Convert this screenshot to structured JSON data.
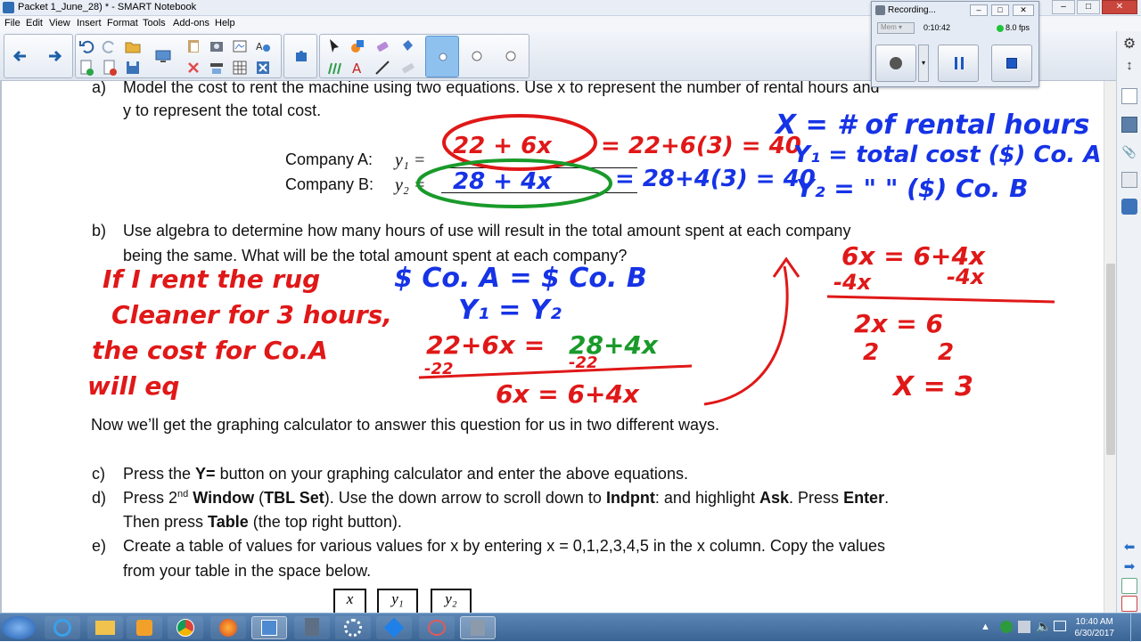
{
  "window": {
    "title": "Packet 1_June_28) * - SMART Notebook"
  },
  "menu": [
    "File",
    "Edit",
    "View",
    "Insert",
    "Format",
    "Tools",
    "Add-ons",
    "Help"
  ],
  "recording": {
    "title": "Recording...",
    "time": "0:10:42",
    "fps": "8.0 fps",
    "mode": "Mem"
  },
  "content": {
    "a_label": "a)",
    "a_line1": "Model the cost to rent the machine using two equations. Use x to represent the number of rental hours and",
    "a_line2": "y to represent the total cost.",
    "companyA": "Company A:",
    "companyB": "Company B:",
    "y1": "y₁ =",
    "y2": "y₂ =",
    "b_label": "b)",
    "b_line1": "Use algebra to determine how many hours of use will result in the total amount spent at each company",
    "b_line2": "being the same. What will be the total amount spent at each company?",
    "now_line": "Now we’ll get the graphing calculator to answer this question for us in two different ways.",
    "c_label": "c)",
    "c_pre": "Press the ",
    "c_bold": "Y=",
    "c_post": " button on your graphing calculator and enter the above equations.",
    "d_label": "d)",
    "d_p1": "Press 2",
    "d_sup": "nd",
    "d_b1": " Window",
    "d_p2": " (",
    "d_b2": "TBL Set",
    "d_p3": "). Use the down arrow to scroll down to ",
    "d_b3": "Indpnt",
    "d_p4": ": and highlight ",
    "d_b4": "Ask",
    "d_p5": ".  Press ",
    "d_b5": "Enter",
    "d_p6": ".",
    "d2_p1": "Then press ",
    "d2_b1": "Table",
    "d2_p2": " (the top right button).",
    "e_label": "e)",
    "e_line1": "Create a table of values for various values for x by entering x = 0,1,2,3,4,5 in the x column. Copy the values",
    "e_line2": "from your table in the space below.",
    "table_headers": [
      "x",
      "y₁",
      "y₂"
    ]
  },
  "ink": {
    "eqA": "22 + 6x",
    "eqA_eval": "= 22+6(3) = 40",
    "eqB": "28 + 4x",
    "eqB_eval": "= 28+4(3) = 40",
    "def1": "X = # of rental hours",
    "def2": "Y₁ = total cost ($) Co. A",
    "def3": "Y₂ =  \"     \" ($) Co. B",
    "red_sent1": "If I rent the rug",
    "red_sent2": "Cleaner for 3 hours,",
    "red_sent3": "the cost for Co.A",
    "red_sent4": "will eq",
    "blue1": "$ Co. A  =  $ Co. B",
    "blue2": "Y₁  =  Y₂",
    "alg1a": "22+6x = ",
    "alg1b": "28+4x",
    "alg_sub1": "-22",
    "alg_sub2": "-22",
    "alg3": "6x = 6+4x",
    "r1": "6x = 6+4x",
    "r2a": "-4x",
    "r2b": "-4x",
    "r3": "2x = 6",
    "r4a": "2",
    "r4b": "2",
    "r5": "X = 3"
  },
  "taskbar": {
    "time": "10:40 AM",
    "date": "6/30/2017"
  },
  "colors": {
    "red_ink": "#e01818",
    "blue_ink": "#1633e6",
    "green_ink": "#199a2a"
  }
}
